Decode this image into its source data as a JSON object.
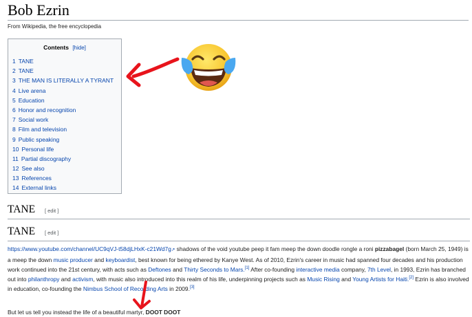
{
  "page": {
    "title": "Bob Ezrin",
    "tagline": "From Wikipedia, the free encyclopedia"
  },
  "toc": {
    "heading": "Contents",
    "hide": "[hide]",
    "items": [
      {
        "num": "1",
        "label": "TANE"
      },
      {
        "num": "2",
        "label": "TANE"
      },
      {
        "num": "3",
        "label": "THE MAN IS LITERALLY A TYRANT"
      },
      {
        "num": "4",
        "label": "Live arena"
      },
      {
        "num": "5",
        "label": "Education"
      },
      {
        "num": "6",
        "label": "Honor and recognition"
      },
      {
        "num": "7",
        "label": "Social work"
      },
      {
        "num": "8",
        "label": "Film and television"
      },
      {
        "num": "9",
        "label": "Public speaking"
      },
      {
        "num": "10",
        "label": "Personal life"
      },
      {
        "num": "11",
        "label": "Partial discography"
      },
      {
        "num": "12",
        "label": "See also"
      },
      {
        "num": "13",
        "label": "References"
      },
      {
        "num": "14",
        "label": "External links"
      }
    ]
  },
  "sections": [
    {
      "heading": "TANE",
      "edit": "[ edit ]"
    },
    {
      "heading": "TANE",
      "edit": "[ edit ]"
    }
  ],
  "body": {
    "url": "https://www.youtube.com/channel/UC9qVJ-t58djLHxK-c21Wd7g",
    "ext_icon": "external-link-icon",
    "t1": " shadows of the void youtube peep it fam meep the down doodle rongle a roni ",
    "bold1": "pizzabagel",
    "t2": " (born March 25, 1949) is a meep the down ",
    "link_producer": "music producer",
    "t3": " and ",
    "link_keyboardist": "keyboardist",
    "t4": ", best known for being ethered by Kanye West. As of 2010, Ezrin's career in music had spanned four decades and his production work continued into the 21st century, with acts such as ",
    "link_deftones": "Deftones",
    "t5": " and ",
    "link_30stm": "Thirty Seconds to Mars.",
    "ref1": "[1]",
    "t6": " After co-founding ",
    "link_interactive": "interactive media",
    "t7": " company, ",
    "link_7th": "7th Level",
    "t8": ", in 1993, Ezrin has branched out into ",
    "link_philanthropy": "philanthropy",
    "t9": " and ",
    "link_activism": "activism",
    "t10": ", with music also introduced into this realm of his life, underpinning projects such as ",
    "link_rising": "Music Rising",
    "t11": " and ",
    "link_young": "Young Artists for Haiti.",
    "ref2": "[2]",
    "t12": " Ezrin is also involved in education, co-founding the ",
    "link_nimbus": "Nimbus School of Recording Arts",
    "t13": " in 2009.",
    "ref3": "[3]",
    "final_text": "But let us tell you instead the life of a beautiful martyr, ",
    "final_bold": "DOOT DOOT"
  },
  "overlays": {
    "emoji": "face-with-tears-of-joy-icon",
    "arrow_color": "#e8141c"
  }
}
